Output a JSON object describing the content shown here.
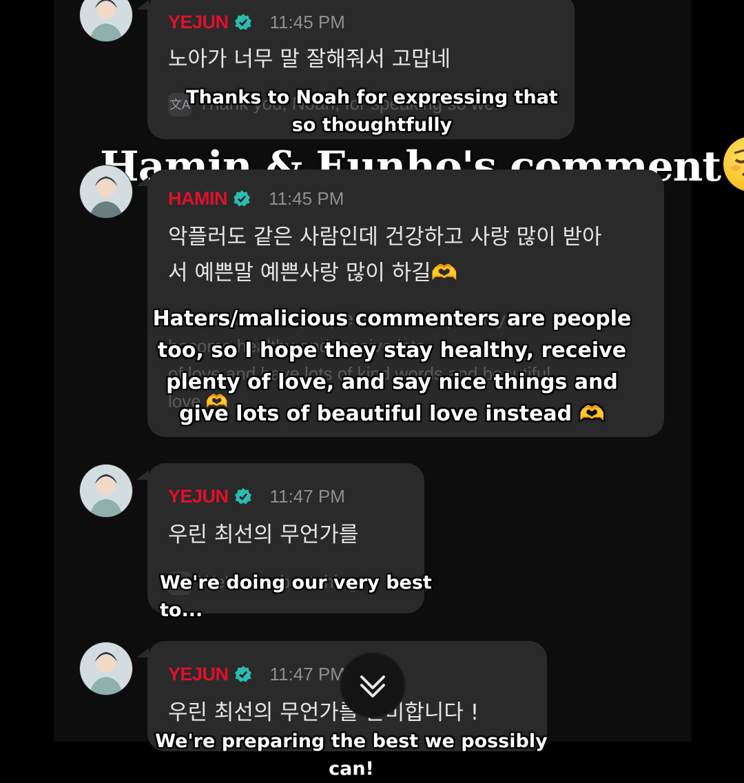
{
  "title_caption": "Hamin & Eunho's comment",
  "colors": {
    "verified": "#2bbdb0",
    "name_red": "#e0102a",
    "time_gray": "#8e8e93"
  },
  "messages": [
    {
      "name": "YEJUN",
      "time": "11:45 PM",
      "text": "노아가 너무 말 잘해줘서 고맙네",
      "translation": "Thank you, Noah, for speaking so well",
      "caption": "Thanks to Noah for expressing that so thoughtfully"
    },
    {
      "name": "HAMIN",
      "time": "11:45 PM",
      "text_lines": [
        "악플러도 같은 사람인데 건강하고 사랑 많이 받아",
        "서 예쁜말 예쁜사랑 많이 하길🫶"
      ],
      "translation_lines": [
        "Even haters are people too, so I hope they",
        "become healthy and receive lots",
        "of love and have lots of kind words and beautiful",
        "love 🫶"
      ],
      "caption_lines": [
        "Haters/malicious commenters are people",
        "too, so I hope they stay healthy, receive",
        "plenty of love, and say nice things and",
        "give lots of beautiful love instead 🫶"
      ]
    },
    {
      "name": "YEJUN",
      "time": "11:47 PM",
      "text": "우린 최선의 무언가를",
      "translation": "We're our best thing",
      "caption": "We're doing our very best to..."
    },
    {
      "name": "YEJUN",
      "time": "11:47 PM",
      "text": "우린 최선의 무언가를 준비합니다 !",
      "caption": "We're preparing the best we possibly can!"
    }
  ],
  "scroll_button_icon": "double-chevron-down-icon"
}
